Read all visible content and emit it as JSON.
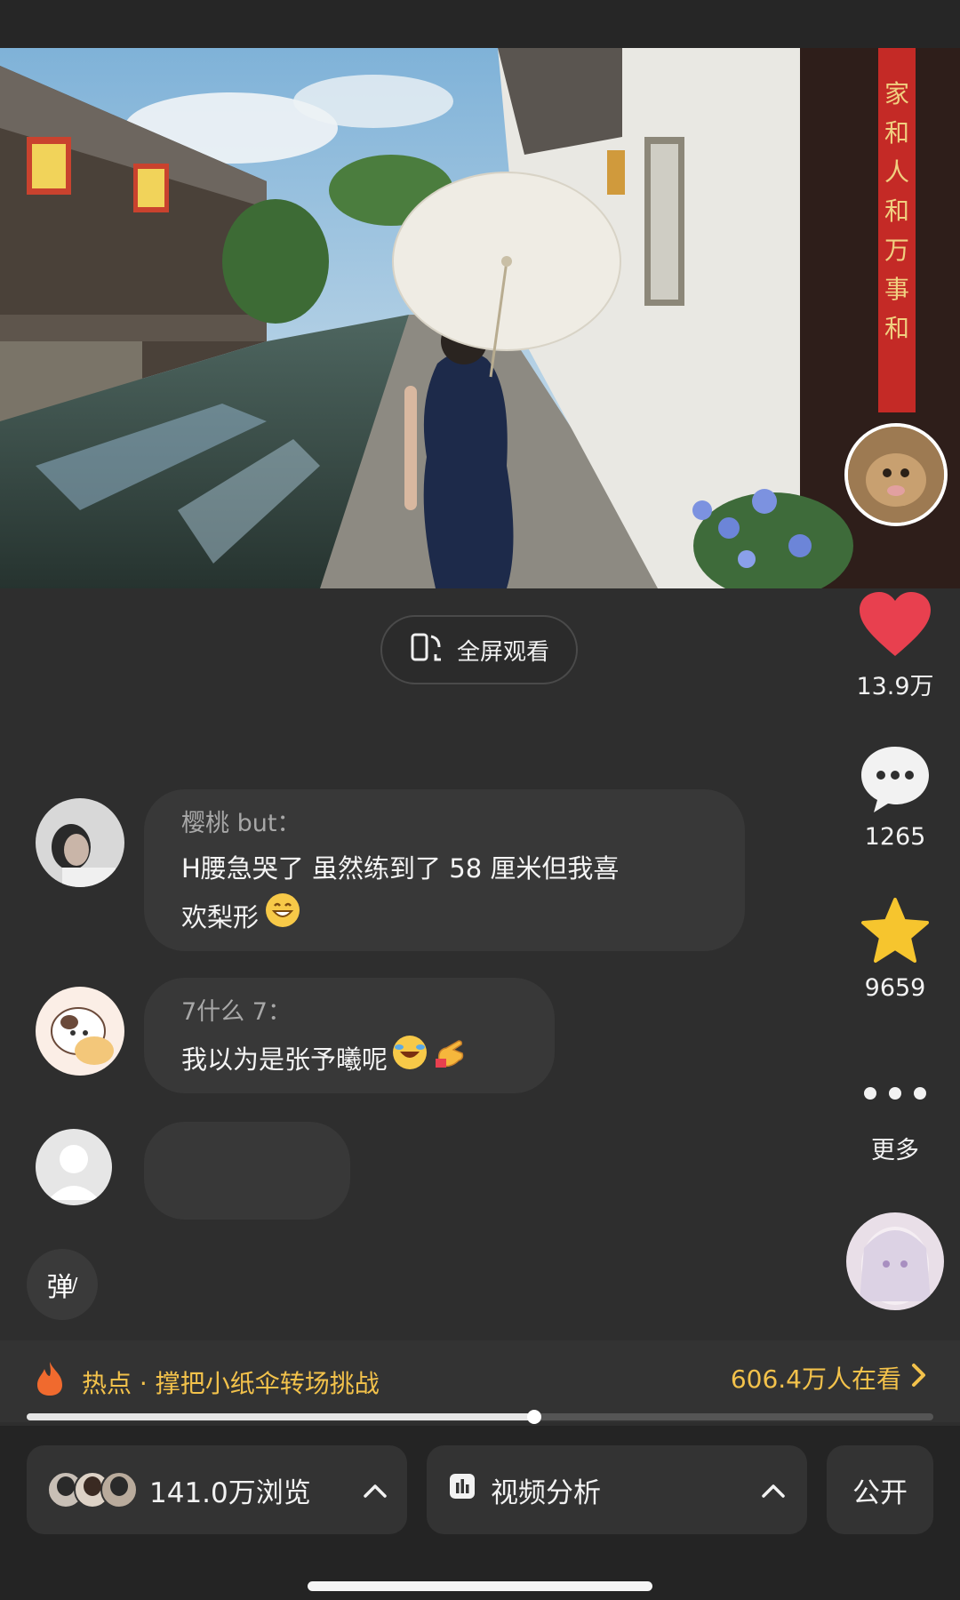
{
  "fullscreen": {
    "label": "全屏观看"
  },
  "rail": {
    "like_count": "13.9万",
    "comment_count": "1265",
    "favorite_count": "9659",
    "more_label": "更多",
    "like_color": "#e8404f",
    "favorite_color": "#f6c52e"
  },
  "comments": [
    {
      "user": "樱桃 but：",
      "text_line1": "H腰急哭了 虽然练到了 58 厘米但我喜",
      "text_line2": "欢梨形",
      "emoji": [
        "grinning-face"
      ]
    },
    {
      "user": "7什么 7：",
      "text": "我以为是张予曦呢",
      "emoji": [
        "rolling-laughing-face",
        "pointing-hand"
      ]
    }
  ],
  "danmu": {
    "label": "弹"
  },
  "hot": {
    "label": "热点 · 撑把小纸伞转场挑战",
    "watching": "606.4万人在看",
    "accent": "#f3c24b"
  },
  "progress": {
    "fraction": 0.56
  },
  "bottom": {
    "views": "141.0万浏览",
    "analysis": "视频分析",
    "visibility": "公开"
  },
  "banner_text": {
    "couplet": "家和人和万事和"
  }
}
